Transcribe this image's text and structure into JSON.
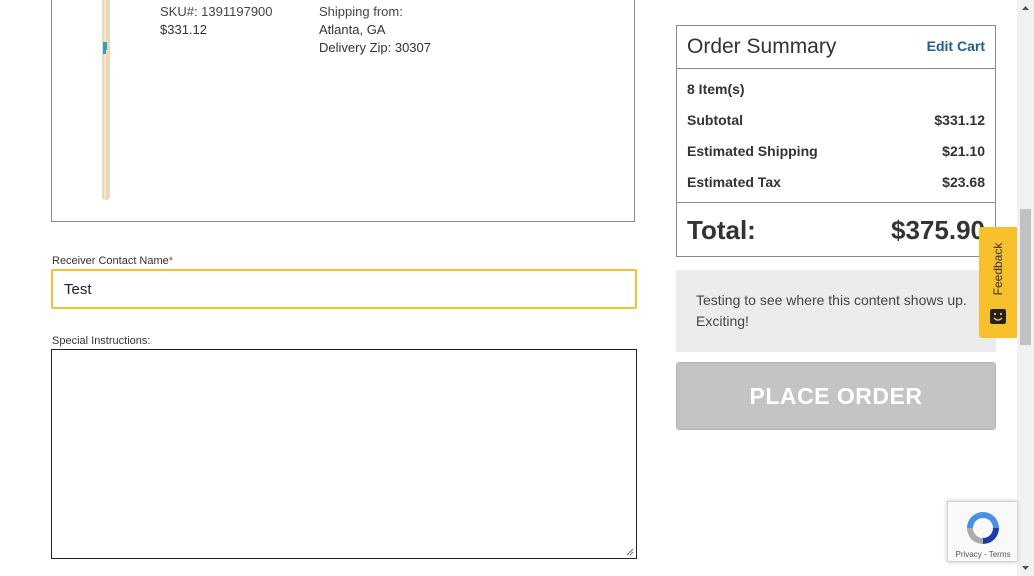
{
  "product": {
    "sku": "SKU#: 1391197900",
    "price": "$331.12",
    "shipping_from_label": "Shipping from:",
    "shipping_city": "Atlanta, GA",
    "delivery_zip": "Delivery Zip: 30307"
  },
  "form": {
    "receiver_label": "Receiver Contact Name",
    "required_mark": "*",
    "receiver_value": "Test",
    "special_label": "Special Instructions:",
    "special_value": ""
  },
  "summary": {
    "title": "Order Summary",
    "edit_cart": "Edit Cart",
    "items": "8 Item(s)",
    "rows": [
      {
        "label": "Subtotal",
        "value": "$331.12"
      },
      {
        "label": "Estimated Shipping",
        "value": "$21.10"
      },
      {
        "label": "Estimated Tax",
        "value": "$23.68"
      }
    ],
    "total_label": "Total:",
    "total_value": "$375.90"
  },
  "notice_text": "Testing to see where this content shows up. Exciting!",
  "place_order": "PLACE ORDER",
  "feedback": "Feedback",
  "recaptcha": {
    "privacy": "Privacy",
    "separator": " - ",
    "terms": "Terms"
  },
  "colors": {
    "accent_yellow": "#f2c230",
    "feedback_yellow": "#f7c12b",
    "link_blue": "#1f5f96",
    "button_disabled": "#c4c4c4",
    "notice_bg": "#ececec"
  }
}
